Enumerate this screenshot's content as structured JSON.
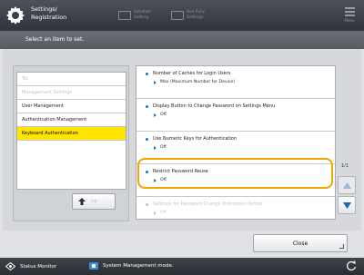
{
  "header": {
    "title_line1": "Settings/",
    "title_line2": "Registration",
    "btn_initialize_line1": "Initialize",
    "btn_initialize_line2": "Setting",
    "btn_usepanel_line1": "Use Func",
    "btn_usepanel_line2": "Settings",
    "menu_label": "Menu"
  },
  "instruction": "Select an item to set.",
  "tree": {
    "items": [
      {
        "label": "Tol",
        "state": "dim"
      },
      {
        "label": "Management Settings",
        "state": "dim"
      },
      {
        "label": "User Management",
        "state": "normal"
      },
      {
        "label": "Authentication Management",
        "state": "normal"
      },
      {
        "label": "Keyboard Authentication",
        "state": "selected"
      }
    ],
    "up_label": "Up"
  },
  "settings": [
    {
      "title": "Number of Caches for Login Users",
      "value": "Max (Maximum Number for Device)",
      "dim": false
    },
    {
      "title": "Display Button to Change Password on Settings Menu",
      "value": "Off",
      "dim": false
    },
    {
      "title": "Use Numeric Keys for Authentication",
      "value": "Off",
      "dim": false
    },
    {
      "title": "Restrict Password Reuse",
      "value": "Off",
      "dim": false
    },
    {
      "title": "Settings for Password Change Prohibition Period",
      "value": "Off",
      "dim": true
    }
  ],
  "page_count": "1/1",
  "close_label": "Close",
  "status": {
    "monitor_label": "Status Monitor",
    "mode_label": "System Management mode."
  },
  "colors": {
    "selection": "#ffe500",
    "highlight": "#f5a300",
    "bullet": "#1a75c9"
  }
}
